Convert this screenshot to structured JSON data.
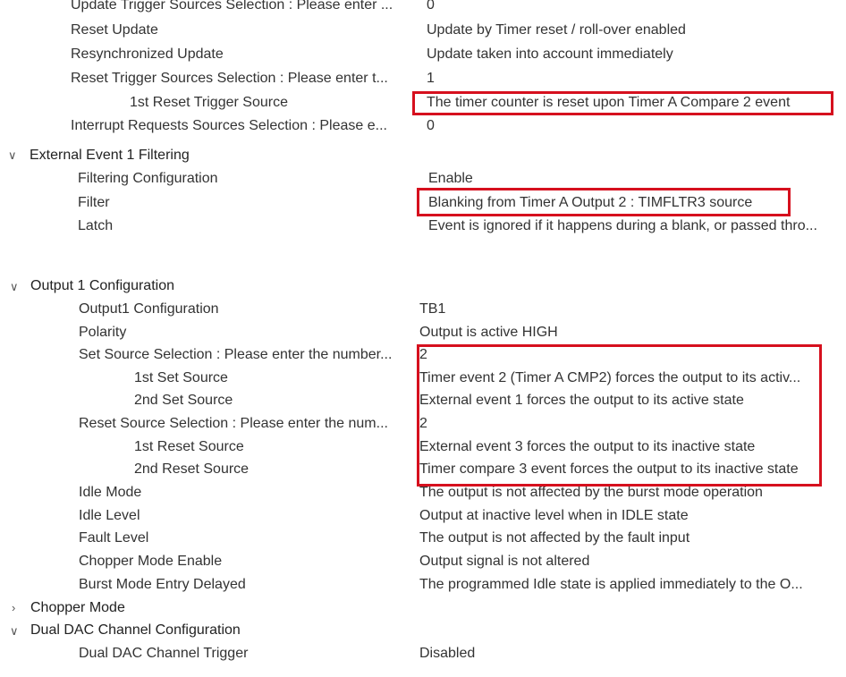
{
  "timer_section": {
    "rows": [
      {
        "label": "Update Trigger Sources Selection : Please enter ...",
        "value": "0"
      },
      {
        "label": "Reset Update",
        "value": "Update by Timer reset / roll-over enabled"
      },
      {
        "label": "Resynchronized Update",
        "value": "Update taken into account immediately"
      },
      {
        "label": "Reset Trigger Sources Selection : Please enter t...",
        "value": "1"
      },
      {
        "label": "1st Reset Trigger Source",
        "value": "The timer counter is reset upon Timer A Compare 2 event"
      },
      {
        "label": "Interrupt Requests Sources Selection : Please e...",
        "value": "0"
      }
    ]
  },
  "external_event": {
    "title": "External Event 1 Filtering",
    "rows": [
      {
        "label": "Filtering Configuration",
        "value": "Enable"
      },
      {
        "label": "Filter",
        "value": "Blanking from Timer A Output 2 : TIMFLTR3 source"
      },
      {
        "label": "Latch",
        "value": "Event is ignored if it happens during a blank, or passed thro..."
      }
    ]
  },
  "output1": {
    "title": "Output 1 Configuration",
    "rows": [
      {
        "label": "Output1 Configuration",
        "value": "TB1"
      },
      {
        "label": "Polarity",
        "value": "Output is active HIGH"
      },
      {
        "label": "Set Source  Selection : Please enter the number...",
        "value": "2"
      },
      {
        "label": "1st Set Source",
        "value": "Timer event 2 (Timer A CMP2) forces the output to its activ..."
      },
      {
        "label": "2nd Set Source",
        "value": "External event 1 forces the output to its active state"
      },
      {
        "label": "Reset Source  Selection : Please enter the num...",
        "value": "2"
      },
      {
        "label": "1st Reset Source",
        "value": "External event 3 forces the output to its inactive state"
      },
      {
        "label": "2nd Reset Source",
        "value": "Timer compare 3 event forces the output to its inactive state"
      },
      {
        "label": "Idle Mode",
        "value": "The output is not affected by the burst mode operation"
      },
      {
        "label": "Idle Level",
        "value": "Output at inactive level when in IDLE state"
      },
      {
        "label": "Fault Level",
        "value": "The output is not affected by the fault input"
      },
      {
        "label": "Chopper Mode Enable",
        "value": "Output signal is not altered"
      },
      {
        "label": "Burst Mode Entry Delayed",
        "value": "The programmed Idle state is applied immediately to the O..."
      }
    ]
  },
  "chopper": {
    "title": "Chopper Mode"
  },
  "dual_dac": {
    "title": "Dual DAC Channel Configuration",
    "rows": [
      {
        "label": "Dual DAC Channel Trigger",
        "value": "Disabled"
      }
    ]
  },
  "highlight_color": "#d6101e"
}
